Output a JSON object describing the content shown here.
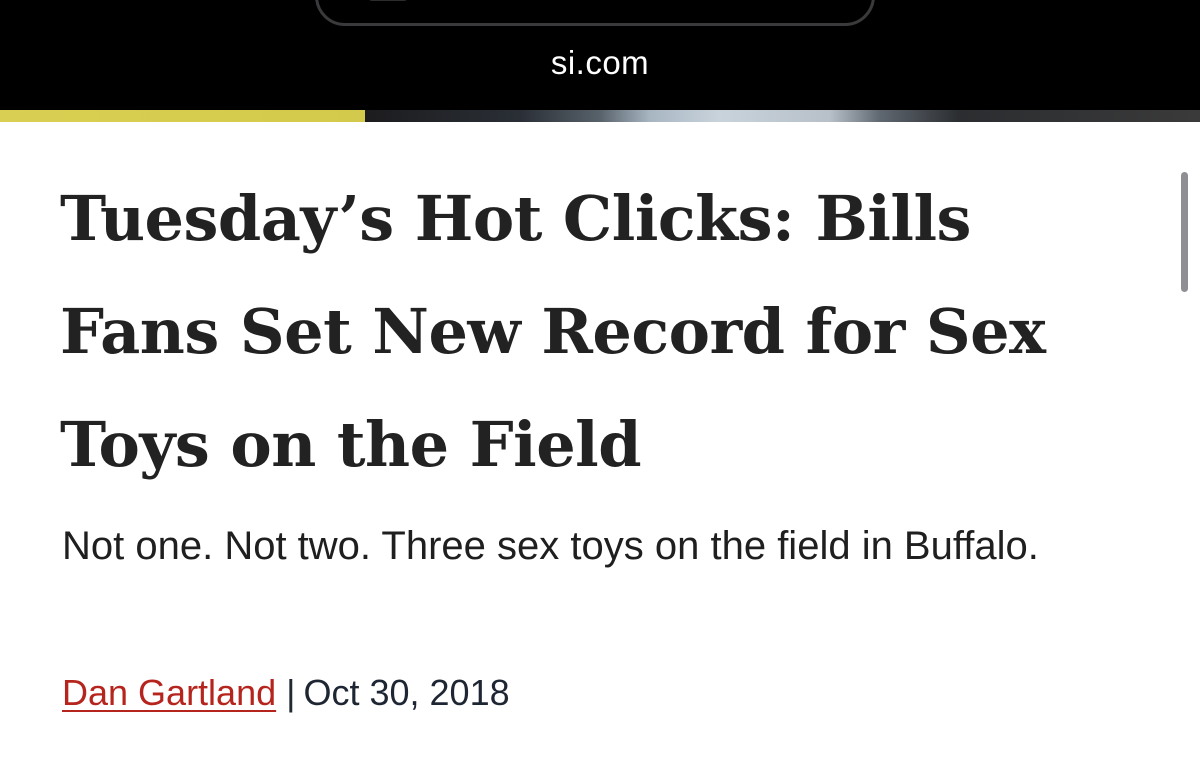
{
  "browser": {
    "domain": "si.com"
  },
  "article": {
    "headline": "Tuesday’s Hot Clicks: Bills Fans Set New Record for Sex Toys on the Field",
    "dek": "Not one. Not two. Three sex toys on the field in Buffalo.",
    "author": "Dan Gartland",
    "separator": "|",
    "date": "Oct 30, 2018"
  },
  "colors": {
    "author_link": "#b5251d",
    "headline_text": "#222222",
    "browser_bar": "#000000"
  }
}
